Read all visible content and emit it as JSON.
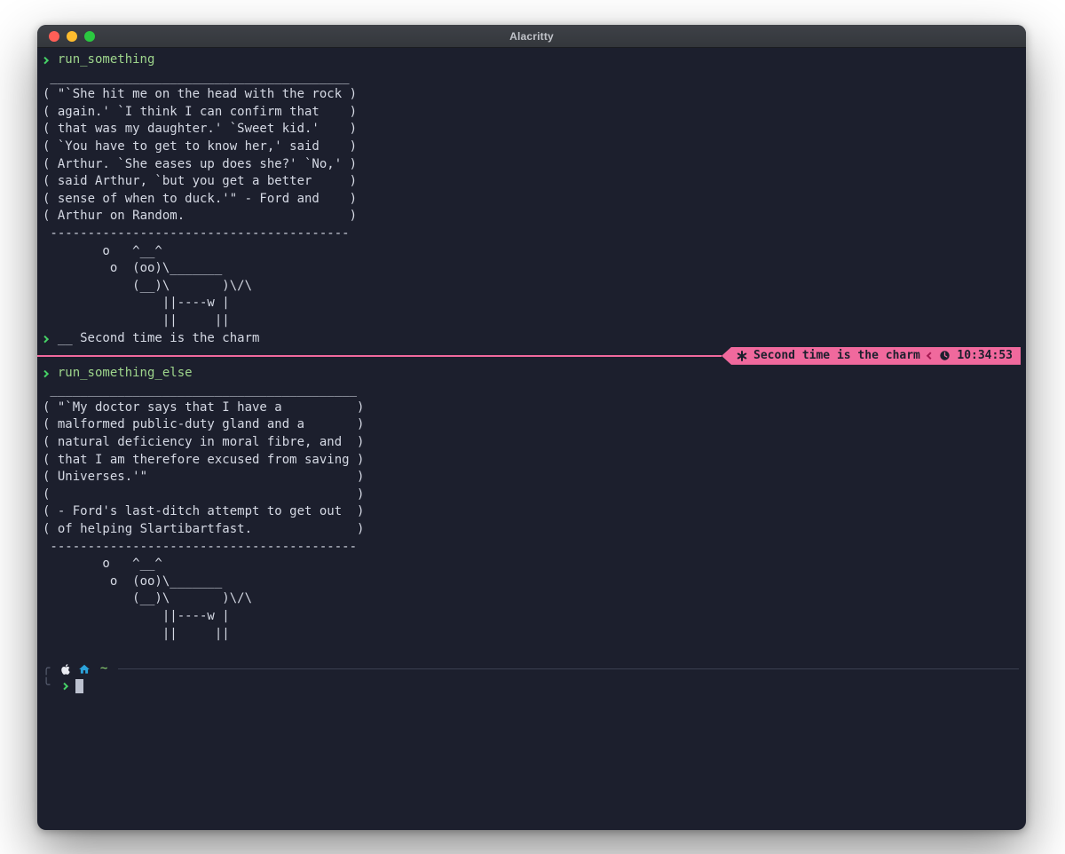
{
  "window": {
    "title": "Alacritty",
    "traffic_lights": [
      {
        "name": "close",
        "color": "#ff5f57"
      },
      {
        "name": "minimize",
        "color": "#febc2e"
      },
      {
        "name": "zoom",
        "color": "#2bc840"
      }
    ]
  },
  "colors": {
    "page_background": "#ffffff",
    "terminal_background": "#1c1f2d",
    "titlebar_top": "#3e4147",
    "titlebar_bottom": "#34373c",
    "titlebar_text": "#c0c3c9",
    "foreground": "#d5d9e4",
    "command_green": "#9ed58c",
    "prompt_arrow_green": "#46d166",
    "pink": "#f0699d",
    "badge_text": "#1c1f2d",
    "badge_chevron": "#a61b53",
    "home_blue": "#2ba3db",
    "apple_white": "#e9ebf1",
    "tilde_green": "#8fd674",
    "bracket_gray": "#5a6073",
    "rule_gray": "#3a3f50",
    "cursor": "#bcc1cf"
  },
  "terminal": {
    "badge": {
      "icon": "asterisk-icon",
      "label": "Second time is the charm",
      "time_icon": "clock-icon",
      "time": "10:34:53"
    },
    "prompt": {
      "corner_top": "╭",
      "corner_bottom": "╰",
      "path": "~"
    },
    "lines": [
      {
        "type": "command",
        "style": "green",
        "text": "run_something"
      },
      {
        "type": "text",
        "text": " ________________________________________"
      },
      {
        "type": "text",
        "text": "( \"`She hit me on the head with the rock )"
      },
      {
        "type": "text",
        "text": "( again.' `I think I can confirm that    )"
      },
      {
        "type": "text",
        "text": "( that was my daughter.' `Sweet kid.'    )"
      },
      {
        "type": "text",
        "text": "( `You have to get to know her,' said    )"
      },
      {
        "type": "text",
        "text": "( Arthur. `She eases up does she?' `No,' )"
      },
      {
        "type": "text",
        "text": "( said Arthur, `but you get a better     )"
      },
      {
        "type": "text",
        "text": "( sense of when to duck.'\" - Ford and    )"
      },
      {
        "type": "text",
        "text": "( Arthur on Random.                      )"
      },
      {
        "type": "text",
        "text": " ----------------------------------------"
      },
      {
        "type": "text",
        "text": "        o   ^__^"
      },
      {
        "type": "text",
        "text": "         o  (oo)\\_______"
      },
      {
        "type": "text",
        "text": "            (__)\\       )\\/\\"
      },
      {
        "type": "text",
        "text": "                ||----w |"
      },
      {
        "type": "text",
        "text": "                ||     ||"
      },
      {
        "type": "command",
        "style": "plain",
        "text": "__ Second time is the charm"
      },
      {
        "type": "separator"
      },
      {
        "type": "command",
        "style": "green",
        "text": "run_something_else"
      },
      {
        "type": "text",
        "text": " _________________________________________"
      },
      {
        "type": "text",
        "text": "( \"`My doctor says that I have a          )"
      },
      {
        "type": "text",
        "text": "( malformed public-duty gland and a       )"
      },
      {
        "type": "text",
        "text": "( natural deficiency in moral fibre, and  )"
      },
      {
        "type": "text",
        "text": "( that I am therefore excused from saving )"
      },
      {
        "type": "text",
        "text": "( Universes.'\"                            )"
      },
      {
        "type": "text",
        "text": "(                                         )"
      },
      {
        "type": "text",
        "text": "( - Ford's last-ditch attempt to get out  )"
      },
      {
        "type": "text",
        "text": "( of helping Slartibartfast.              )"
      },
      {
        "type": "text",
        "text": " -----------------------------------------"
      },
      {
        "type": "text",
        "text": "        o   ^__^"
      },
      {
        "type": "text",
        "text": "         o  (oo)\\_______"
      },
      {
        "type": "text",
        "text": "            (__)\\       )\\/\\"
      },
      {
        "type": "text",
        "text": "                ||----w |"
      },
      {
        "type": "text",
        "text": "                ||     ||"
      },
      {
        "type": "blank"
      },
      {
        "type": "prompt-top"
      },
      {
        "type": "prompt-bottom"
      }
    ]
  }
}
